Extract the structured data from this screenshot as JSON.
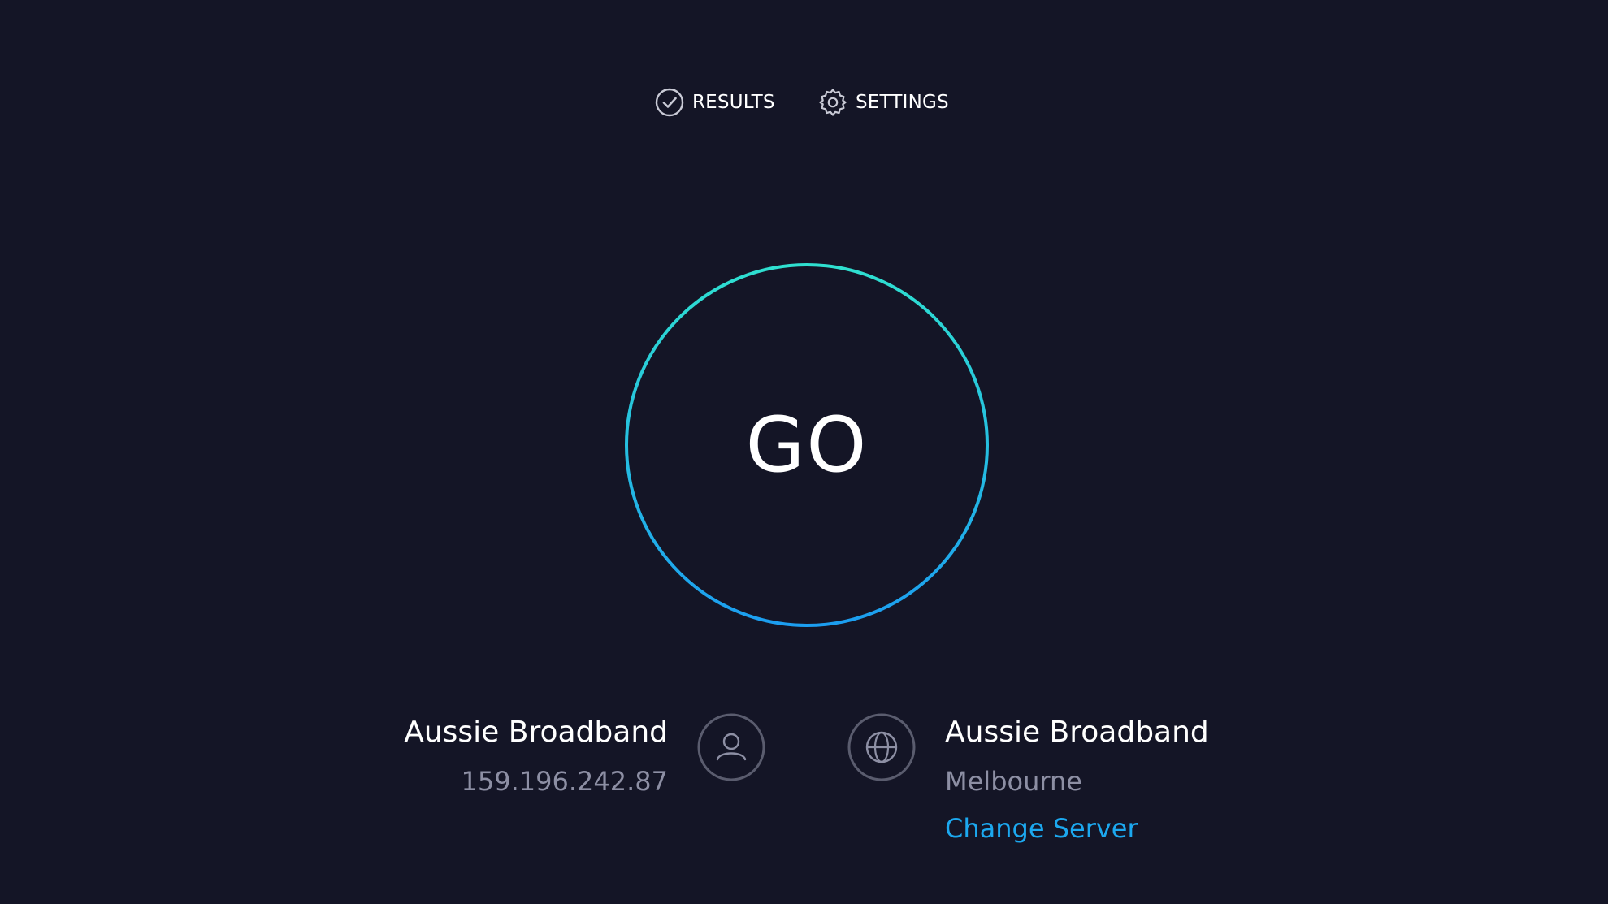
{
  "nav": {
    "results": {
      "label": "RESULTS",
      "icon": "check-circle-icon"
    },
    "settings": {
      "label": "SETTINGS",
      "icon": "gear-icon"
    }
  },
  "start": {
    "label": "GO",
    "ring_gradient": [
      "#2fe0d0",
      "#1c9ef0"
    ]
  },
  "isp": {
    "name": "Aussie Broadband",
    "ip": "159.196.242.87",
    "icon": "user-icon"
  },
  "server": {
    "name": "Aussie Broadband",
    "location": "Melbourne",
    "change_label": "Change Server",
    "icon": "globe-icon"
  },
  "colors": {
    "background": "#141526",
    "text": "#ffffff",
    "muted": "#8d8fa4",
    "link": "#1ca8ef",
    "icon_stroke": "#5a5c6e"
  }
}
